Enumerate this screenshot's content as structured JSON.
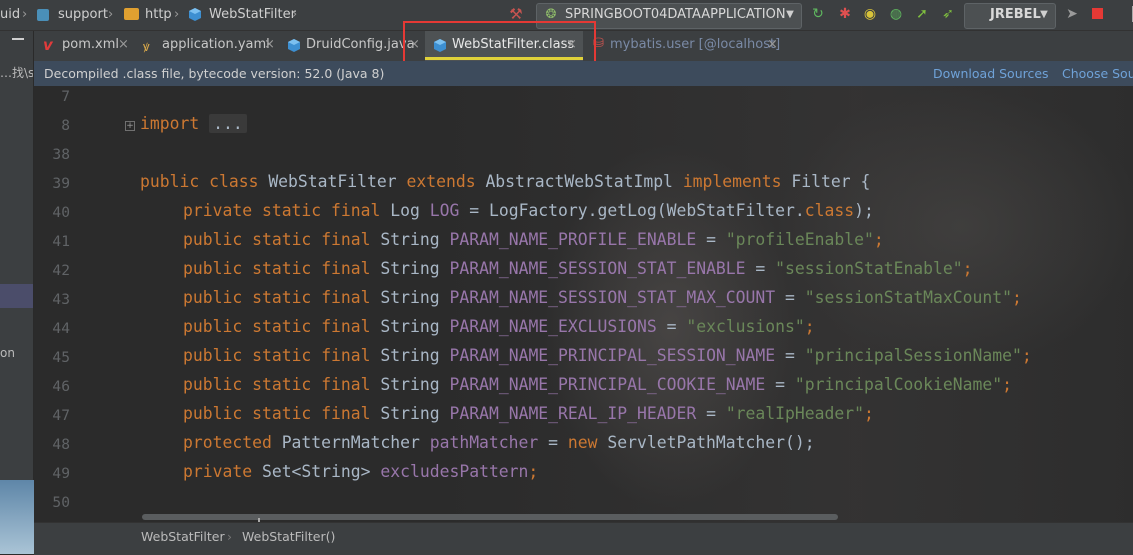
{
  "nav": {
    "breadcrumb": [
      "uid",
      "support",
      "http",
      "WebStatFilter"
    ],
    "run_config": "SPRINGBOOT04DATAAPPLICATION",
    "jrebel": "JREBEL",
    "colors": {
      "run": "#4caf50",
      "debug": "#e53935",
      "stop": "#e53935"
    }
  },
  "left": {
    "text1": "…找\\spr",
    "text2": "on"
  },
  "tabs": [
    {
      "label": "pom.xml",
      "icon": "maven-icon"
    },
    {
      "label": "application.yaml",
      "icon": "yaml-icon"
    },
    {
      "label": "DruidConfig.java",
      "icon": "class-icon"
    },
    {
      "label": "WebStatFilter.class",
      "icon": "class-icon",
      "active": true
    },
    {
      "label": "mybatis.user [@localhost]",
      "icon": "db-icon"
    }
  ],
  "close_glyph": "×",
  "info": {
    "text": "Decompiled .class file, bytecode version: 52.0 (Java 8)",
    "download": "Download Sources",
    "choose": "Choose Sou"
  },
  "code": {
    "line_numbers": [
      "7",
      "8",
      "38",
      "39",
      "40",
      "41",
      "42",
      "43",
      "44",
      "45",
      "46",
      "47",
      "48",
      "49",
      "50"
    ],
    "kw_import": "import",
    "fold_ellipsis": "...",
    "kw_public": "public",
    "kw_private": "private",
    "kw_protected": "protected",
    "kw_static": "static",
    "kw_final": "final",
    "kw_class": "class",
    "kw_extends": "extends",
    "kw_implements": "implements",
    "kw_new": "new",
    "class_name": "WebStatFilter",
    "super_class": "AbstractWebStatImpl",
    "iface": "Filter",
    "brace": " {",
    "t_log": "Log",
    "f_log": "LOG",
    "log_rest": " = LogFactory.getLog(WebStatFilter.",
    "log_end": ");",
    "t_string": "String",
    "eq": " = ",
    "semi": ";",
    "fields": [
      {
        "name": "PARAM_NAME_PROFILE_ENABLE",
        "value": "\"profileEnable\""
      },
      {
        "name": "PARAM_NAME_SESSION_STAT_ENABLE",
        "value": "\"sessionStatEnable\""
      },
      {
        "name": "PARAM_NAME_SESSION_STAT_MAX_COUNT",
        "value": "\"sessionStatMaxCount\""
      },
      {
        "name": "PARAM_NAME_EXCLUSIONS",
        "value": "\"exclusions\""
      },
      {
        "name": "PARAM_NAME_PRINCIPAL_SESSION_NAME",
        "value": "\"principalSessionName\""
      },
      {
        "name": "PARAM_NAME_PRINCIPAL_COOKIE_NAME",
        "value": "\"principalCookieName\""
      },
      {
        "name": "PARAM_NAME_REAL_IP_HEADER",
        "value": "\"realIpHeader\""
      }
    ],
    "pm_type": "PatternMatcher",
    "pm_name": "pathMatcher",
    "pm_ctor": "ServletPathMatcher();",
    "ex_type": "Set<String>",
    "ex_name": "excludesPattern"
  },
  "bottom": {
    "crumb1": "WebStatFilter",
    "crumb2": "WebStatFilter()"
  }
}
